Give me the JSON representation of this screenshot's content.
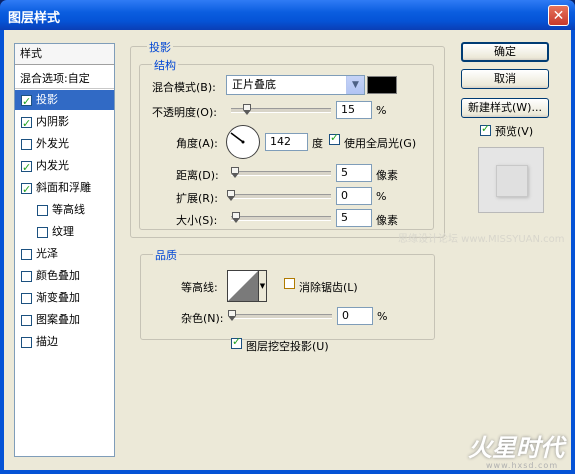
{
  "window": {
    "title": "图层样式"
  },
  "icons": {
    "close": "close-icon"
  },
  "style_list": {
    "header": "样式",
    "blend_options": "混合选项:自定",
    "items": [
      {
        "label": "投影",
        "checked": true,
        "selected": true
      },
      {
        "label": "内阴影",
        "checked": true
      },
      {
        "label": "外发光",
        "checked": false
      },
      {
        "label": "内发光",
        "checked": true
      },
      {
        "label": "斜面和浮雕",
        "checked": true
      },
      {
        "label": "等高线",
        "checked": false,
        "sub": true
      },
      {
        "label": "纹理",
        "checked": false,
        "sub": true
      },
      {
        "label": "光泽",
        "checked": false
      },
      {
        "label": "颜色叠加",
        "checked": false
      },
      {
        "label": "渐变叠加",
        "checked": false
      },
      {
        "label": "图案叠加",
        "checked": false
      },
      {
        "label": "描边",
        "checked": false
      }
    ]
  },
  "buttons": {
    "ok": "确定",
    "cancel": "取消",
    "new_style": "新建样式(W)...",
    "preview_label": "预览(V)",
    "preview_checked": true
  },
  "drop_shadow": {
    "section": "投影",
    "structure": "结构",
    "blend_mode_label": "混合模式(B):",
    "blend_mode_value": "正片叠底",
    "shadow_color": "#000000",
    "opacity_label": "不透明度(O):",
    "opacity_value": "15",
    "percent": "%",
    "angle_label": "角度(A):",
    "angle_value": "142",
    "degree_unit": "度",
    "global_light_label": "使用全局光(G)",
    "global_light_checked": true,
    "distance_label": "距离(D):",
    "distance_value": "5",
    "spread_label": "扩展(R):",
    "spread_value": "0",
    "size_label": "大小(S):",
    "size_value": "5",
    "pixel_unit": "像素",
    "quality": "品质",
    "contour_label": "等高线:",
    "anti_alias_label": "消除锯齿(L)",
    "anti_alias_checked": false,
    "noise_label": "杂色(N):",
    "noise_value": "0",
    "knockout_label": "图层挖空投影(U)",
    "knockout_checked": true
  },
  "watermark": "思缘设计论坛 www.MISSYUAN.com",
  "logo": "火星时代",
  "logo_url": "www.hxsd.com"
}
